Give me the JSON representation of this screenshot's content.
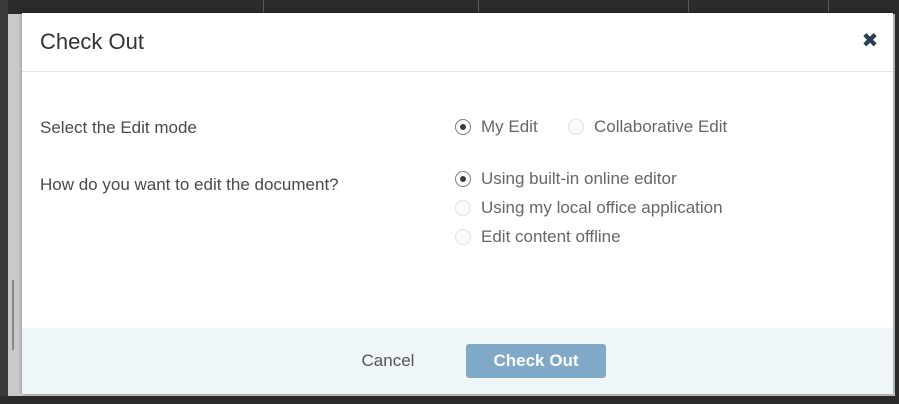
{
  "dialog": {
    "title": "Check Out",
    "close_icon": "close-icon"
  },
  "edit_mode": {
    "label": "Select the Edit mode",
    "options": [
      {
        "label": "My Edit",
        "checked": true
      },
      {
        "label": "Collaborative Edit",
        "checked": false
      }
    ]
  },
  "edit_method": {
    "label": "How do you want to edit the document?",
    "options": [
      {
        "label": "Using built-in online editor",
        "checked": true
      },
      {
        "label": "Using my local office application",
        "checked": false
      },
      {
        "label": "Edit content offline",
        "checked": false
      }
    ]
  },
  "footer": {
    "cancel_label": "Cancel",
    "checkout_label": "Check Out"
  },
  "colors": {
    "primary_button": "#7fa9c7",
    "footer_bg": "#eef6f8",
    "close_icon": "#2d3e50"
  }
}
